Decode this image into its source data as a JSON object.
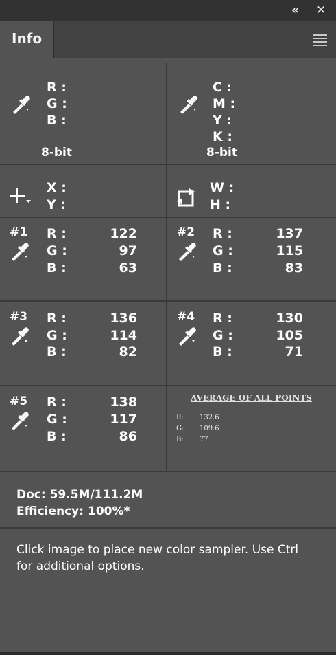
{
  "panel": {
    "tab": "Info",
    "collapse_glyph": "«",
    "close_glyph": "✕"
  },
  "color_readout_1": {
    "labels": [
      "R :",
      "G :",
      "B :"
    ],
    "bit_depth": "8-bit",
    "icon": "eyedropper-icon"
  },
  "color_readout_2": {
    "labels": [
      "C :",
      "M :",
      "Y :",
      "K :"
    ],
    "bit_depth": "8-bit",
    "icon": "eyedropper-icon"
  },
  "position": {
    "labels": [
      "X :",
      "Y :"
    ],
    "icon": "crosshair-icon"
  },
  "size": {
    "labels": [
      "W :",
      "H :"
    ],
    "icon": "transform-box-icon"
  },
  "samplers": [
    {
      "name": "#1",
      "r_label": "R :",
      "g_label": "G :",
      "b_label": "B :",
      "r": "122",
      "g": "97",
      "b": "63"
    },
    {
      "name": "#2",
      "r_label": "R :",
      "g_label": "G :",
      "b_label": "B :",
      "r": "137",
      "g": "115",
      "b": "83"
    },
    {
      "name": "#3",
      "r_label": "R :",
      "g_label": "G :",
      "b_label": "B :",
      "r": "136",
      "g": "114",
      "b": "82"
    },
    {
      "name": "#4",
      "r_label": "R :",
      "g_label": "G :",
      "b_label": "B :",
      "r": "130",
      "g": "105",
      "b": "71"
    },
    {
      "name": "#5",
      "r_label": "R :",
      "g_label": "G :",
      "b_label": "B :",
      "r": "138",
      "g": "117",
      "b": "86"
    }
  ],
  "average": {
    "title": "AVERAGE OF ALL POINTS",
    "rows": [
      {
        "label": "R:",
        "value": "132.6"
      },
      {
        "label": "G:",
        "value": "109.6"
      },
      {
        "label": "B:",
        "value": "77"
      }
    ]
  },
  "doc_info": {
    "doc": "Doc: 59.5M/111.2M",
    "efficiency": "Efficiency: 100%*"
  },
  "hint": "Click image to place new color sampler.  Use Ctrl for additional options.",
  "colors": {
    "panel_bg": "#535353",
    "tab_bar": "#424242",
    "top_bar": "#323232",
    "divider": "#3a3a3a"
  }
}
